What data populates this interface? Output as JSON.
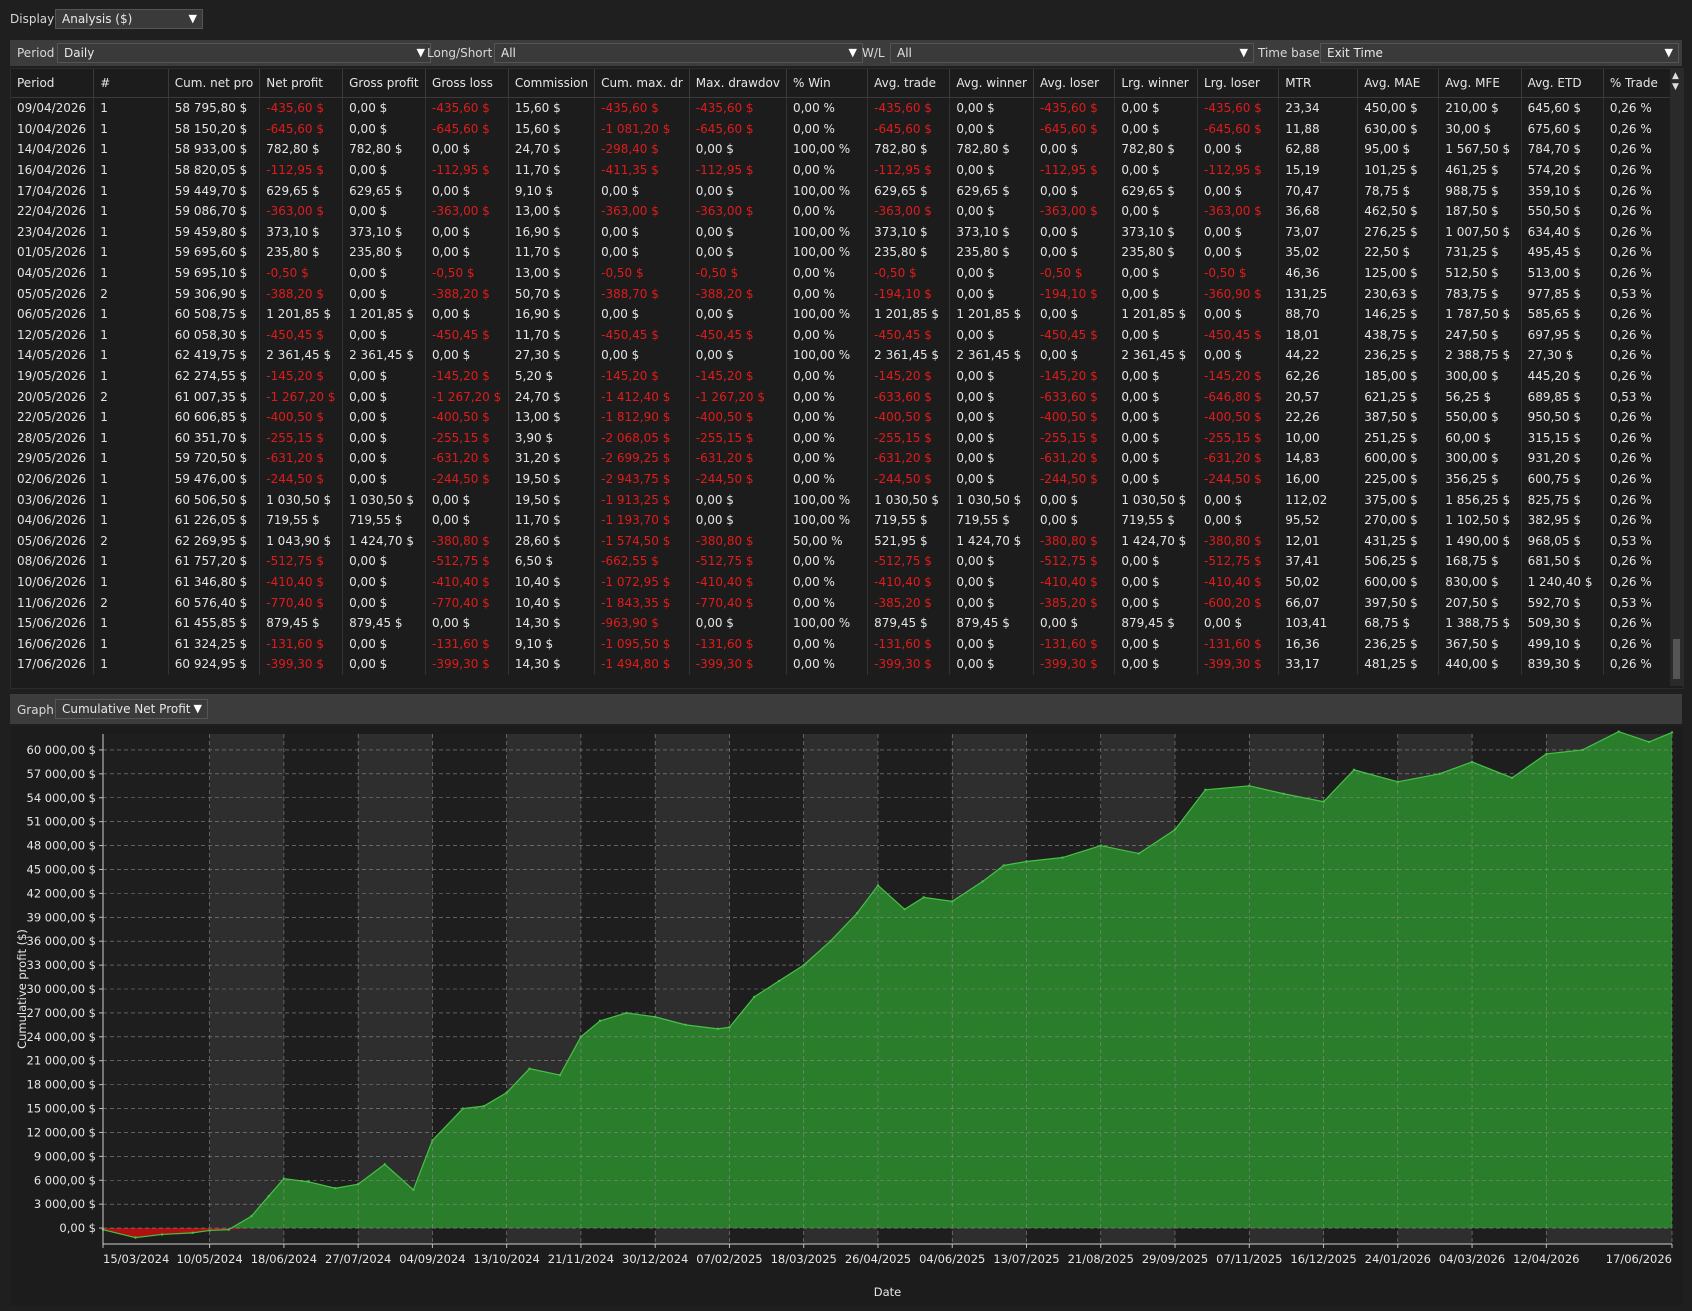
{
  "display": {
    "label": "Display",
    "value": "Analysis ($)"
  },
  "filters": {
    "period_label": "Period",
    "period_value": "Daily",
    "longshort_label": "Long/Short",
    "longshort_value": "All",
    "wl_label": "W/L",
    "wl_value": "All",
    "timebase_label": "Time base",
    "timebase_value": "Exit Time"
  },
  "table": {
    "columns": [
      "Period",
      "#",
      "Cum. net pro",
      "Net profit",
      "Gross profit",
      "Gross loss",
      "Commission",
      "Cum. max. dr",
      "Max. drawdov",
      "% Win",
      "Avg. trade",
      "Avg. winner",
      "Avg. loser",
      "Lrg. winner",
      "Lrg. loser",
      "MTR",
      "Avg. MAE",
      "Avg. MFE",
      "Avg. ETD",
      "% Trade"
    ],
    "rows": [
      [
        "09/04/2026",
        "1",
        "58 795,80 $",
        "-435,60 $",
        "0,00 $",
        "-435,60 $",
        "15,60 $",
        "-435,60 $",
        "-435,60 $",
        "0,00 %",
        "-435,60 $",
        "0,00 $",
        "-435,60 $",
        "0,00 $",
        "-435,60 $",
        "23,34",
        "450,00 $",
        "210,00 $",
        "645,60 $",
        "0,26 %"
      ],
      [
        "10/04/2026",
        "1",
        "58 150,20 $",
        "-645,60 $",
        "0,00 $",
        "-645,60 $",
        "15,60 $",
        "-1 081,20 $",
        "-645,60 $",
        "0,00 %",
        "-645,60 $",
        "0,00 $",
        "-645,60 $",
        "0,00 $",
        "-645,60 $",
        "11,88",
        "630,00 $",
        "30,00 $",
        "675,60 $",
        "0,26 %"
      ],
      [
        "14/04/2026",
        "1",
        "58 933,00 $",
        "782,80 $",
        "782,80 $",
        "0,00 $",
        "24,70 $",
        "-298,40 $",
        "0,00 $",
        "100,00 %",
        "782,80 $",
        "782,80 $",
        "0,00 $",
        "782,80 $",
        "0,00 $",
        "62,88",
        "95,00 $",
        "1 567,50 $",
        "784,70 $",
        "0,26 %"
      ],
      [
        "16/04/2026",
        "1",
        "58 820,05 $",
        "-112,95 $",
        "0,00 $",
        "-112,95 $",
        "11,70 $",
        "-411,35 $",
        "-112,95 $",
        "0,00 %",
        "-112,95 $",
        "0,00 $",
        "-112,95 $",
        "0,00 $",
        "-112,95 $",
        "15,19",
        "101,25 $",
        "461,25 $",
        "574,20 $",
        "0,26 %"
      ],
      [
        "17/04/2026",
        "1",
        "59 449,70 $",
        "629,65 $",
        "629,65 $",
        "0,00 $",
        "9,10 $",
        "0,00 $",
        "0,00 $",
        "100,00 %",
        "629,65 $",
        "629,65 $",
        "0,00 $",
        "629,65 $",
        "0,00 $",
        "70,47",
        "78,75 $",
        "988,75 $",
        "359,10 $",
        "0,26 %"
      ],
      [
        "22/04/2026",
        "1",
        "59 086,70 $",
        "-363,00 $",
        "0,00 $",
        "-363,00 $",
        "13,00 $",
        "-363,00 $",
        "-363,00 $",
        "0,00 %",
        "-363,00 $",
        "0,00 $",
        "-363,00 $",
        "0,00 $",
        "-363,00 $",
        "36,68",
        "462,50 $",
        "187,50 $",
        "550,50 $",
        "0,26 %"
      ],
      [
        "23/04/2026",
        "1",
        "59 459,80 $",
        "373,10 $",
        "373,10 $",
        "0,00 $",
        "16,90 $",
        "0,00 $",
        "0,00 $",
        "100,00 %",
        "373,10 $",
        "373,10 $",
        "0,00 $",
        "373,10 $",
        "0,00 $",
        "73,07",
        "276,25 $",
        "1 007,50 $",
        "634,40 $",
        "0,26 %"
      ],
      [
        "01/05/2026",
        "1",
        "59 695,60 $",
        "235,80 $",
        "235,80 $",
        "0,00 $",
        "11,70 $",
        "0,00 $",
        "0,00 $",
        "100,00 %",
        "235,80 $",
        "235,80 $",
        "0,00 $",
        "235,80 $",
        "0,00 $",
        "35,02",
        "22,50 $",
        "731,25 $",
        "495,45 $",
        "0,26 %"
      ],
      [
        "04/05/2026",
        "1",
        "59 695,10 $",
        "-0,50 $",
        "0,00 $",
        "-0,50 $",
        "13,00 $",
        "-0,50 $",
        "-0,50 $",
        "0,00 %",
        "-0,50 $",
        "0,00 $",
        "-0,50 $",
        "0,00 $",
        "-0,50 $",
        "46,36",
        "125,00 $",
        "512,50 $",
        "513,00 $",
        "0,26 %"
      ],
      [
        "05/05/2026",
        "2",
        "59 306,90 $",
        "-388,20 $",
        "0,00 $",
        "-388,20 $",
        "50,70 $",
        "-388,70 $",
        "-388,20 $",
        "0,00 %",
        "-194,10 $",
        "0,00 $",
        "-194,10 $",
        "0,00 $",
        "-360,90 $",
        "131,25",
        "230,63 $",
        "783,75 $",
        "977,85 $",
        "0,53 %"
      ],
      [
        "06/05/2026",
        "1",
        "60 508,75 $",
        "1 201,85 $",
        "1 201,85 $",
        "0,00 $",
        "16,90 $",
        "0,00 $",
        "0,00 $",
        "100,00 %",
        "1 201,85 $",
        "1 201,85 $",
        "0,00 $",
        "1 201,85 $",
        "0,00 $",
        "88,70",
        "146,25 $",
        "1 787,50 $",
        "585,65 $",
        "0,26 %"
      ],
      [
        "12/05/2026",
        "1",
        "60 058,30 $",
        "-450,45 $",
        "0,00 $",
        "-450,45 $",
        "11,70 $",
        "-450,45 $",
        "-450,45 $",
        "0,00 %",
        "-450,45 $",
        "0,00 $",
        "-450,45 $",
        "0,00 $",
        "-450,45 $",
        "18,01",
        "438,75 $",
        "247,50 $",
        "697,95 $",
        "0,26 %"
      ],
      [
        "14/05/2026",
        "1",
        "62 419,75 $",
        "2 361,45 $",
        "2 361,45 $",
        "0,00 $",
        "27,30 $",
        "0,00 $",
        "0,00 $",
        "100,00 %",
        "2 361,45 $",
        "2 361,45 $",
        "0,00 $",
        "2 361,45 $",
        "0,00 $",
        "44,22",
        "236,25 $",
        "2 388,75 $",
        "27,30 $",
        "0,26 %"
      ],
      [
        "19/05/2026",
        "1",
        "62 274,55 $",
        "-145,20 $",
        "0,00 $",
        "-145,20 $",
        "5,20 $",
        "-145,20 $",
        "-145,20 $",
        "0,00 %",
        "-145,20 $",
        "0,00 $",
        "-145,20 $",
        "0,00 $",
        "-145,20 $",
        "62,26",
        "185,00 $",
        "300,00 $",
        "445,20 $",
        "0,26 %"
      ],
      [
        "20/05/2026",
        "2",
        "61 007,35 $",
        "-1 267,20 $",
        "0,00 $",
        "-1 267,20 $",
        "24,70 $",
        "-1 412,40 $",
        "-1 267,20 $",
        "0,00 %",
        "-633,60 $",
        "0,00 $",
        "-633,60 $",
        "0,00 $",
        "-646,80 $",
        "20,57",
        "621,25 $",
        "56,25 $",
        "689,85 $",
        "0,53 %"
      ],
      [
        "22/05/2026",
        "1",
        "60 606,85 $",
        "-400,50 $",
        "0,00 $",
        "-400,50 $",
        "13,00 $",
        "-1 812,90 $",
        "-400,50 $",
        "0,00 %",
        "-400,50 $",
        "0,00 $",
        "-400,50 $",
        "0,00 $",
        "-400,50 $",
        "22,26",
        "387,50 $",
        "550,00 $",
        "950,50 $",
        "0,26 %"
      ],
      [
        "28/05/2026",
        "1",
        "60 351,70 $",
        "-255,15 $",
        "0,00 $",
        "-255,15 $",
        "3,90 $",
        "-2 068,05 $",
        "-255,15 $",
        "0,00 %",
        "-255,15 $",
        "0,00 $",
        "-255,15 $",
        "0,00 $",
        "-255,15 $",
        "10,00",
        "251,25 $",
        "60,00 $",
        "315,15 $",
        "0,26 %"
      ],
      [
        "29/05/2026",
        "1",
        "59 720,50 $",
        "-631,20 $",
        "0,00 $",
        "-631,20 $",
        "31,20 $",
        "-2 699,25 $",
        "-631,20 $",
        "0,00 %",
        "-631,20 $",
        "0,00 $",
        "-631,20 $",
        "0,00 $",
        "-631,20 $",
        "14,83",
        "600,00 $",
        "300,00 $",
        "931,20 $",
        "0,26 %"
      ],
      [
        "02/06/2026",
        "1",
        "59 476,00 $",
        "-244,50 $",
        "0,00 $",
        "-244,50 $",
        "19,50 $",
        "-2 943,75 $",
        "-244,50 $",
        "0,00 %",
        "-244,50 $",
        "0,00 $",
        "-244,50 $",
        "0,00 $",
        "-244,50 $",
        "16,00",
        "225,00 $",
        "356,25 $",
        "600,75 $",
        "0,26 %"
      ],
      [
        "03/06/2026",
        "1",
        "60 506,50 $",
        "1 030,50 $",
        "1 030,50 $",
        "0,00 $",
        "19,50 $",
        "-1 913,25 $",
        "0,00 $",
        "100,00 %",
        "1 030,50 $",
        "1 030,50 $",
        "0,00 $",
        "1 030,50 $",
        "0,00 $",
        "112,02",
        "375,00 $",
        "1 856,25 $",
        "825,75 $",
        "0,26 %"
      ],
      [
        "04/06/2026",
        "1",
        "61 226,05 $",
        "719,55 $",
        "719,55 $",
        "0,00 $",
        "11,70 $",
        "-1 193,70 $",
        "0,00 $",
        "100,00 %",
        "719,55 $",
        "719,55 $",
        "0,00 $",
        "719,55 $",
        "0,00 $",
        "95,52",
        "270,00 $",
        "1 102,50 $",
        "382,95 $",
        "0,26 %"
      ],
      [
        "05/06/2026",
        "2",
        "62 269,95 $",
        "1 043,90 $",
        "1 424,70 $",
        "-380,80 $",
        "28,60 $",
        "-1 574,50 $",
        "-380,80 $",
        "50,00 %",
        "521,95 $",
        "1 424,70 $",
        "-380,80 $",
        "1 424,70 $",
        "-380,80 $",
        "12,01",
        "431,25 $",
        "1 490,00 $",
        "968,05 $",
        "0,53 %"
      ],
      [
        "08/06/2026",
        "1",
        "61 757,20 $",
        "-512,75 $",
        "0,00 $",
        "-512,75 $",
        "6,50 $",
        "-662,55 $",
        "-512,75 $",
        "0,00 %",
        "-512,75 $",
        "0,00 $",
        "-512,75 $",
        "0,00 $",
        "-512,75 $",
        "37,41",
        "506,25 $",
        "168,75 $",
        "681,50 $",
        "0,26 %"
      ],
      [
        "10/06/2026",
        "1",
        "61 346,80 $",
        "-410,40 $",
        "0,00 $",
        "-410,40 $",
        "10,40 $",
        "-1 072,95 $",
        "-410,40 $",
        "0,00 %",
        "-410,40 $",
        "0,00 $",
        "-410,40 $",
        "0,00 $",
        "-410,40 $",
        "50,02",
        "600,00 $",
        "830,00 $",
        "1 240,40 $",
        "0,26 %"
      ],
      [
        "11/06/2026",
        "2",
        "60 576,40 $",
        "-770,40 $",
        "0,00 $",
        "-770,40 $",
        "10,40 $",
        "-1 843,35 $",
        "-770,40 $",
        "0,00 %",
        "-385,20 $",
        "0,00 $",
        "-385,20 $",
        "0,00 $",
        "-600,20 $",
        "66,07",
        "397,50 $",
        "207,50 $",
        "592,70 $",
        "0,53 %"
      ],
      [
        "15/06/2026",
        "1",
        "61 455,85 $",
        "879,45 $",
        "879,45 $",
        "0,00 $",
        "14,30 $",
        "-963,90 $",
        "0,00 $",
        "100,00 %",
        "879,45 $",
        "879,45 $",
        "0,00 $",
        "879,45 $",
        "0,00 $",
        "103,41",
        "68,75 $",
        "1 388,75 $",
        "509,30 $",
        "0,26 %"
      ],
      [
        "16/06/2026",
        "1",
        "61 324,25 $",
        "-131,60 $",
        "0,00 $",
        "-131,60 $",
        "9,10 $",
        "-1 095,50 $",
        "-131,60 $",
        "0,00 %",
        "-131,60 $",
        "0,00 $",
        "-131,60 $",
        "0,00 $",
        "-131,60 $",
        "16,36",
        "236,25 $",
        "367,50 $",
        "499,10 $",
        "0,26 %"
      ],
      [
        "17/06/2026",
        "1",
        "60 924,95 $",
        "-399,30 $",
        "0,00 $",
        "-399,30 $",
        "14,30 $",
        "-1 494,80 $",
        "-399,30 $",
        "0,00 %",
        "-399,30 $",
        "0,00 $",
        "-399,30 $",
        "0,00 $",
        "-399,30 $",
        "33,17",
        "481,25 $",
        "440,00 $",
        "839,30 $",
        "0,26 %"
      ]
    ]
  },
  "graph": {
    "label": "Graph",
    "value": "Cumulative Net Profit"
  },
  "colors": {
    "negative": "#e11b1b",
    "fill": "#2a7d2a",
    "line": "#45c245",
    "loss_fill": "#b01010"
  },
  "chart_data": {
    "type": "area",
    "xlabel": "Date",
    "ylabel": "Cumulative profit ($)",
    "ylim": [
      -2000,
      62000
    ],
    "yticks": [
      "0,00 $",
      "3 000,00 $",
      "6 000,00 $",
      "9 000,00 $",
      "12 000,00 $",
      "15 000,00 $",
      "18 000,00 $",
      "21 000,00 $",
      "24 000,00 $",
      "27 000,00 $",
      "30 000,00 $",
      "33 000,00 $",
      "36 000,00 $",
      "39 000,00 $",
      "42 000,00 $",
      "45 000,00 $",
      "48 000,00 $",
      "51 000,00 $",
      "54 000,00 $",
      "57 000,00 $",
      "60 000,00 $"
    ],
    "xticks": [
      "15/03/2024",
      "10/05/2024",
      "18/06/2024",
      "27/07/2024",
      "04/09/2024",
      "13/10/2024",
      "21/11/2024",
      "30/12/2024",
      "07/02/2025",
      "18/03/2025",
      "26/04/2025",
      "04/06/2025",
      "13/07/2025",
      "21/08/2025",
      "29/09/2025",
      "07/11/2025",
      "16/12/2025",
      "24/01/2026",
      "04/03/2026",
      "12/04/2026",
      "17/06/2026"
    ],
    "grid": true,
    "series": [
      {
        "x": [
          "15/03/2024",
          "01/04/2024",
          "15/04/2024",
          "01/05/2024",
          "10/05/2024",
          "20/05/2024",
          "01/06/2024",
          "10/06/2024",
          "18/06/2024",
          "01/07/2024",
          "15/07/2024",
          "27/07/2024",
          "10/08/2024",
          "25/08/2024",
          "04/09/2024",
          "20/09/2024",
          "01/10/2024",
          "13/10/2024",
          "25/10/2024",
          "10/11/2024",
          "21/11/2024",
          "01/12/2024",
          "15/12/2024",
          "30/12/2024",
          "15/01/2025",
          "01/02/2025",
          "07/02/2025",
          "20/02/2025",
          "05/03/2025",
          "18/03/2025",
          "01/04/2025",
          "15/04/2025",
          "26/04/2025",
          "10/05/2025",
          "20/05/2025",
          "04/06/2025",
          "20/06/2025",
          "01/07/2025",
          "13/07/2025",
          "01/08/2025",
          "21/08/2025",
          "10/09/2025",
          "29/09/2025",
          "15/10/2025",
          "07/11/2025",
          "25/11/2025",
          "16/12/2025",
          "01/01/2026",
          "24/01/2026",
          "15/02/2026",
          "04/03/2026",
          "25/03/2026",
          "12/04/2026",
          "01/05/2026",
          "20/05/2026",
          "05/06/2026",
          "17/06/2026"
        ],
        "values": [
          -200,
          -1200,
          -800,
          -600,
          -300,
          -200,
          1500,
          4000,
          6200,
          5800,
          5000,
          5500,
          8000,
          4800,
          11000,
          15000,
          15300,
          17000,
          20000,
          19200,
          24000,
          26000,
          27000,
          26500,
          25500,
          25000,
          25200,
          29000,
          31000,
          33000,
          36000,
          39500,
          43000,
          40000,
          41500,
          41000,
          43500,
          45500,
          46000,
          46500,
          48000,
          47000,
          50000,
          55000,
          55500,
          54500,
          53500,
          57500,
          56000,
          57000,
          58500,
          56500,
          59500,
          60000,
          62300,
          61000,
          62200
        ]
      }
    ]
  }
}
